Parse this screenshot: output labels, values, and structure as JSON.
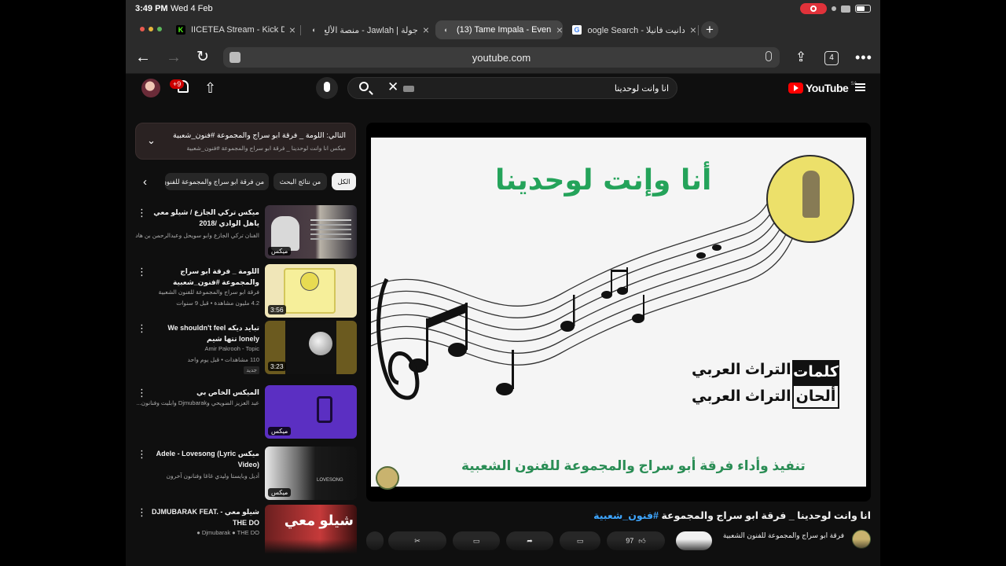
{
  "status": {
    "time": "3:49 PM",
    "date": "Wed 4 Feb"
  },
  "tabs": [
    {
      "label": "IICETEA Stream - Kick D",
      "favicon_color": "#53fc18",
      "favicon": "K"
    },
    {
      "label": "جولة | Jawlah - منصة الألع",
      "favicon_color": "#888888",
      "favicon": "◐"
    },
    {
      "label": "(13) Tame Impala - Even",
      "favicon_color": "#888888",
      "favicon": "◐"
    },
    {
      "label": "دانيت فانيلا - Google Search",
      "favicon_color": "#4285f4",
      "favicon": "G"
    }
  ],
  "browser": {
    "url": "youtube.com",
    "tab_count": "4"
  },
  "yt": {
    "wordmark": "YouTube",
    "region": "SA",
    "notification_badge": "+9",
    "search_query": "انا وانت لوحدينا"
  },
  "queue": {
    "title": "التالي: اللومة _ فرقة ابو سراج والمجموعة #فنون_شعبية",
    "subtitle": "ميكس انا وانت لوحدينا _ فرقة ابو سراج والمجموعة #فنون_شعبية"
  },
  "chips": {
    "all": "الكل",
    "from_search": "من نتائج البحث",
    "from_channel": "من فرقة ابو سراج والمجموعة للفنون الشعبية"
  },
  "recommendations": [
    {
      "title": "ميكس تركي الجازع / شيلو معي ياهل الوادي /2018",
      "channel": "الفنان تركي الجازع وابو سويحل وعبدالرحمن بن هاد...",
      "meta": "",
      "badge": "ميكس",
      "duration": ""
    },
    {
      "title": "اللومة _ فرقة ابو سراج والمجموعة #فنون_شعبية",
      "channel": "فرقة ابو سراج والمجموعة للفنون الشعبية",
      "meta": "4.2 مليون مشاهدة • قبل 9 سنوات",
      "badge": "",
      "duration": "3:56"
    },
    {
      "title": "تبايد ديكه We shouldn't feel lonely تتها شيم",
      "channel": "Amir Pakrooh - Topic",
      "meta": "110 مشاهدات • قبل يوم واحد",
      "badge": "",
      "duration": "3:23",
      "new_label": "جديد"
    },
    {
      "title": "الميكس الخاص بي",
      "channel": "عبد العزيز الضويحي وDjmubarak وابليت وفنانون...",
      "meta": "",
      "badge": "ميكس",
      "duration": ""
    },
    {
      "title": "ميكس Adele - Lovesong (Lyric Video)",
      "channel": "أديل وبايستا وليدي غاغا وفنانون آخرون",
      "meta": "",
      "badge": "ميكس",
      "duration": "",
      "thumb_text": "LOVESONG"
    },
    {
      "title": "شيلو معي - DJMUBARAK FEAT. THE DO",
      "channel": "Djmubarak ● THE DO ●",
      "meta": "",
      "badge": "",
      "duration": "",
      "thumb_text": "شيلو معي"
    }
  ],
  "video": {
    "art_title": "أنا وإنت لوحدينا",
    "credit_box_1": "كلمات",
    "credit_text_1": "التراث العربي",
    "credit_box_2": "ألحان",
    "credit_text_2": "التراث العربي",
    "performers": "تنفيذ وأداء فرقة أبو سراج والمجموعة للفنون الشعبية"
  },
  "main": {
    "title": "انا وانت لوحدينا _ فرقة ابو سراج والمجموعة",
    "hashtag": "#فنون_شعبية",
    "channel": "فرقة ابو سراج والمجموعة للفنون الشعبية",
    "likes": "97"
  },
  "colors": {
    "yt_red": "#ff0000",
    "link_blue": "#3ea6ff",
    "art_green": "#24a35a"
  }
}
